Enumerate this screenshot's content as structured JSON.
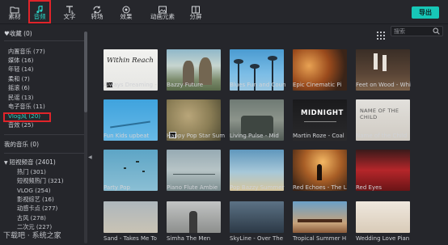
{
  "toolbar": {
    "tabs": [
      {
        "label": "素材",
        "icon": "folder-icon"
      },
      {
        "label": "音频",
        "icon": "music-note-icon"
      },
      {
        "label": "文字",
        "icon": "text-icon"
      },
      {
        "label": "转场",
        "icon": "transition-icon"
      },
      {
        "label": "效果",
        "icon": "effects-icon"
      },
      {
        "label": "动画元素",
        "icon": "elements-icon"
      },
      {
        "label": "分屏",
        "icon": "split-screen-icon"
      }
    ],
    "export_label": "导出"
  },
  "sidebar": {
    "favorites": "♥收藏 (0)",
    "items": [
      {
        "label": "内置音乐 (77)"
      },
      {
        "label": "媒体 (16)"
      },
      {
        "label": "年轻 (14)"
      },
      {
        "label": "柔和 (7)"
      },
      {
        "label": "摇滚 (6)"
      },
      {
        "label": "民谣 (13)"
      },
      {
        "label": "电子音乐 (11)"
      },
      {
        "label": "Vlog风 (20)"
      },
      {
        "label": "音效 (25)"
      }
    ],
    "my_music": "我的音乐 (0)",
    "short_video": "短视频音 (2401)",
    "sub_items": [
      {
        "label": "热门 (301)"
      },
      {
        "label": "短视频热门 (321)"
      },
      {
        "label": "VLOG (254)"
      },
      {
        "label": "影视综艺 (16)"
      },
      {
        "label": "动感卡点 (277)"
      },
      {
        "label": "古风 (278)"
      },
      {
        "label": "二次元 (227)"
      }
    ],
    "watermark": "下载吧 · 系统之家"
  },
  "search": {
    "placeholder": "搜索"
  },
  "tracks": [
    {
      "title": "Always Dreaming -"
    },
    {
      "title": "Bazzy Future"
    },
    {
      "title": "Blues Fun and Coun"
    },
    {
      "title": "Epic Cinematic Pi"
    },
    {
      "title": "Feet on Wood - Whi"
    },
    {
      "title": "Fun Kids upbeat"
    },
    {
      "title": "Happy Pop Star Sum"
    },
    {
      "title": "Living Pulse - Mid"
    },
    {
      "title": "Martin Roze - Coal"
    },
    {
      "title": "Name of the Child"
    },
    {
      "title": "Party Pop"
    },
    {
      "title": "Piano Flute Ambie"
    },
    {
      "title": "Pop Bazzy Summer"
    },
    {
      "title": "Red Echoes - The L"
    },
    {
      "title": "Red Eyes"
    },
    {
      "title": "Sand - Takes Me To"
    },
    {
      "title": "Simha The Men"
    },
    {
      "title": "SkyLine - Over The"
    },
    {
      "title": "Tropical Summer H"
    },
    {
      "title": "Wedding Love Pian"
    }
  ],
  "thumb_text": {
    "within_reach": "Within Reach",
    "midnight": "MIDNIGHT",
    "name_child": "NAME OF THE CHILD"
  },
  "colors": {
    "accent": "#17c7b7",
    "highlight": "#e0242a",
    "selected_text": "#2bd3c5"
  }
}
